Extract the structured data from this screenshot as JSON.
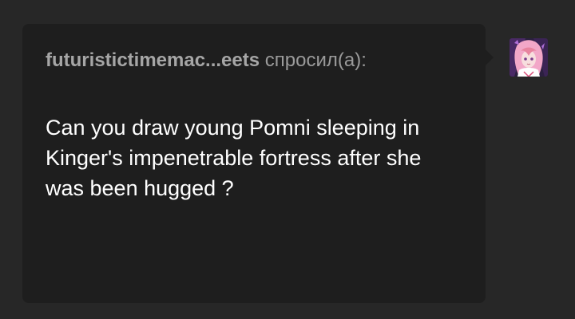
{
  "ask": {
    "asker_name": "futuristictimemac...eets",
    "asked_label": "спросил(а):",
    "question": "Can you draw young Pomni sleeping in Kinger's impenetrable fortress after she was been hugged ?"
  },
  "avatar": {
    "icon": "anime-character-avatar"
  },
  "colors": {
    "page_background": "#272727",
    "card_background": "#1e1e1e",
    "question_text": "#ffffff",
    "header_text": "#9a9a9a"
  }
}
